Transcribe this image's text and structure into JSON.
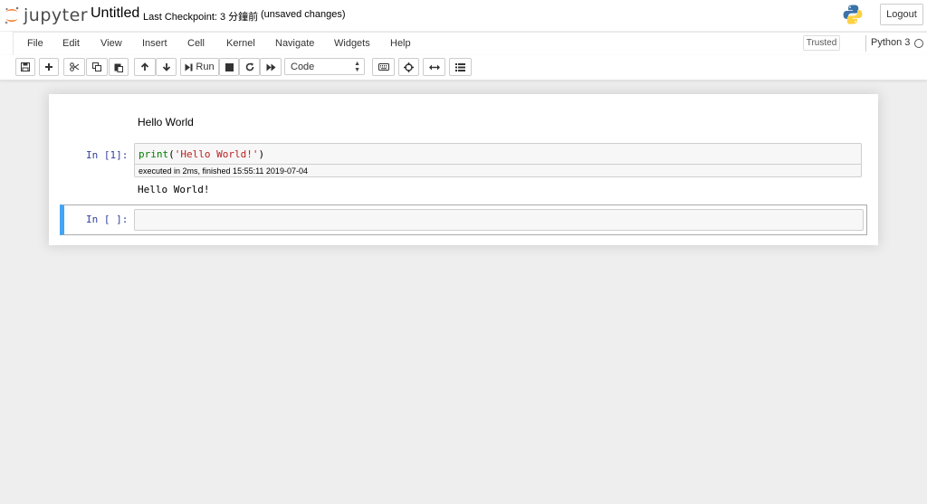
{
  "header": {
    "logo_text": "jupyter",
    "notebook_title": "Untitled",
    "checkpoint": "Last Checkpoint: 3 分鐘前",
    "unsaved": "(unsaved changes)",
    "logout_label": "Logout"
  },
  "menubar": {
    "items": [
      "File",
      "Edit",
      "View",
      "Insert",
      "Cell",
      "Kernel",
      "Navigate",
      "Widgets",
      "Help"
    ],
    "trusted_label": "Trusted",
    "kernel_name": "Python 3"
  },
  "toolbar": {
    "run_label": "Run",
    "cell_type": "Code"
  },
  "notebook": {
    "markdown_text": "Hello World",
    "cell1": {
      "prompt": "In [1]:",
      "code_func": "print",
      "code_open": "(",
      "code_string": "'Hello World!'",
      "code_close": ")",
      "execution_info": "executed in 2ms, finished 15:55:11 2019-07-04",
      "output": "Hello World!"
    },
    "cell2": {
      "prompt": "In [ ]:"
    }
  },
  "colors": {
    "selected_border": "#42a5f5",
    "prompt_color": "#303f9f",
    "keyword": "#008000",
    "string": "#ba2121",
    "jupyter_orange": "#f37726"
  }
}
